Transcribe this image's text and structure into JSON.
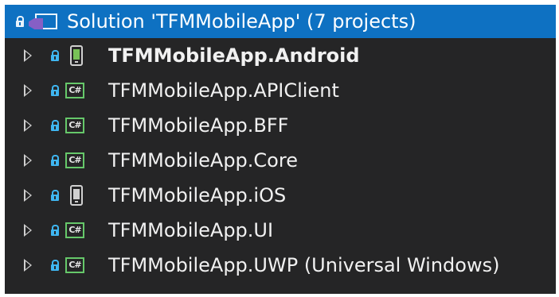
{
  "solution": {
    "label": "Solution 'TFMMobileApp' (7 projects)"
  },
  "projects": [
    {
      "label": "TFMMobileApp.Android",
      "icon": "android-phone-icon",
      "bold": true
    },
    {
      "label": "TFMMobileApp.APIClient",
      "icon": "csharp-project-icon"
    },
    {
      "label": "TFMMobileApp.BFF",
      "icon": "csharp-project-icon"
    },
    {
      "label": "TFMMobileApp.Core",
      "icon": "csharp-project-icon"
    },
    {
      "label": "TFMMobileApp.iOS",
      "icon": "ios-phone-icon"
    },
    {
      "label": "TFMMobileApp.UI",
      "icon": "csharp-project-icon"
    },
    {
      "label": "TFMMobileApp.UWP (Universal Windows)",
      "icon": "csharp-project-icon"
    }
  ],
  "icons": {
    "csharp_text": "C#"
  },
  "colors": {
    "background": "#252526",
    "selection": "#0e71c2",
    "text": "#f1f1f1",
    "lock": "#3fb6f1",
    "csharp_border": "#66c86a",
    "android_green": "#78c257",
    "vs_purple": "#865fc5"
  }
}
